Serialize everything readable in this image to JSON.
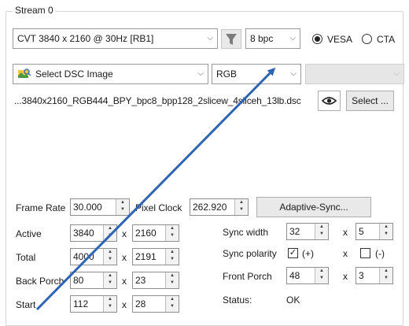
{
  "group": {
    "title": "Stream 0"
  },
  "timing": {
    "selected": "CVT 3840 x 2160 @ 30Hz [RB1]"
  },
  "bpc": {
    "selected": "8 bpc"
  },
  "standard": {
    "vesa": "VESA",
    "cta": "CTA",
    "selected": "VESA"
  },
  "dsc": {
    "selected": "Select DSC Image",
    "icon": "color-image-icon"
  },
  "color_format": {
    "selected": "RGB"
  },
  "third_combo": {
    "value": ""
  },
  "dsc_file": {
    "path": "...3840x2160_RGB444_BPY_bpc8_bpp128_2slicew_4sliceh_13lb.dsc",
    "select_label": "Select ..."
  },
  "frame_rate": {
    "label": "Frame Rate",
    "value": "30.000"
  },
  "pixel_clock": {
    "label": "Pixel Clock",
    "value": "262.920"
  },
  "adaptive_sync": {
    "label": "Adaptive-Sync..."
  },
  "x_sep": "x",
  "rows": {
    "active": {
      "label": "Active",
      "h": "3840",
      "v": "2160"
    },
    "total": {
      "label": "Total",
      "h": "4000",
      "v": "2191"
    },
    "back_porch": {
      "label": "Back Porch",
      "h": "80",
      "v": "23"
    },
    "start": {
      "label": "Start",
      "h": "112",
      "v": "28"
    }
  },
  "sync_width": {
    "label": "Sync width",
    "h": "32",
    "v": "5"
  },
  "sync_polarity": {
    "label": "Sync polarity",
    "h_label": "(+)",
    "h_checked": true,
    "v_label": "(-)",
    "v_checked": false
  },
  "front_porch": {
    "label": "Front Porch",
    "h": "48",
    "v": "3"
  },
  "status": {
    "label": "Status:",
    "value": "OK"
  },
  "annotation": {
    "color": "#2e64b4"
  }
}
